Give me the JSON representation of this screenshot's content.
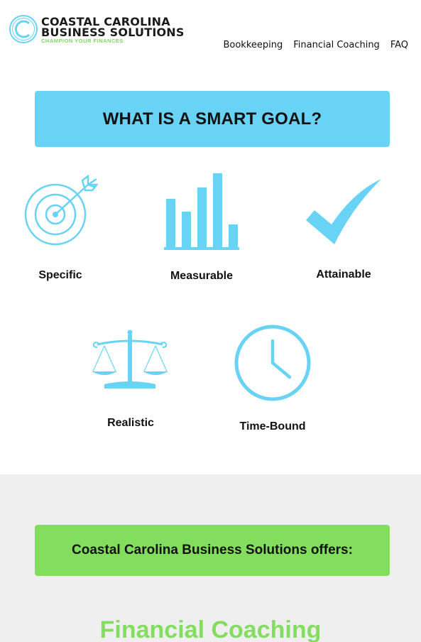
{
  "brand": {
    "line1": "COASTAL CAROLINA",
    "line2": "BUSINESS SOLUTIONS",
    "tagline": "CHAMPION YOUR FINANCES",
    "accent_blue": "#68d3f5",
    "accent_green": "#83de5f"
  },
  "nav": {
    "items": [
      {
        "label": "Bookkeeping"
      },
      {
        "label": "Financial Coaching"
      },
      {
        "label": "FAQ"
      }
    ]
  },
  "banner": {
    "title": "WHAT IS A SMART GOAL?"
  },
  "goals": [
    {
      "label": "Specific",
      "icon": "target-arrow-icon"
    },
    {
      "label": "Measurable",
      "icon": "bar-chart-icon"
    },
    {
      "label": "Attainable",
      "icon": "checkmark-icon"
    },
    {
      "label": "Realistic",
      "icon": "scales-icon"
    },
    {
      "label": "Time-Bound",
      "icon": "clock-icon"
    }
  ],
  "offers": {
    "text": "Coastal Carolina Business Solutions offers:"
  },
  "service": {
    "title": "Financial Coaching"
  }
}
